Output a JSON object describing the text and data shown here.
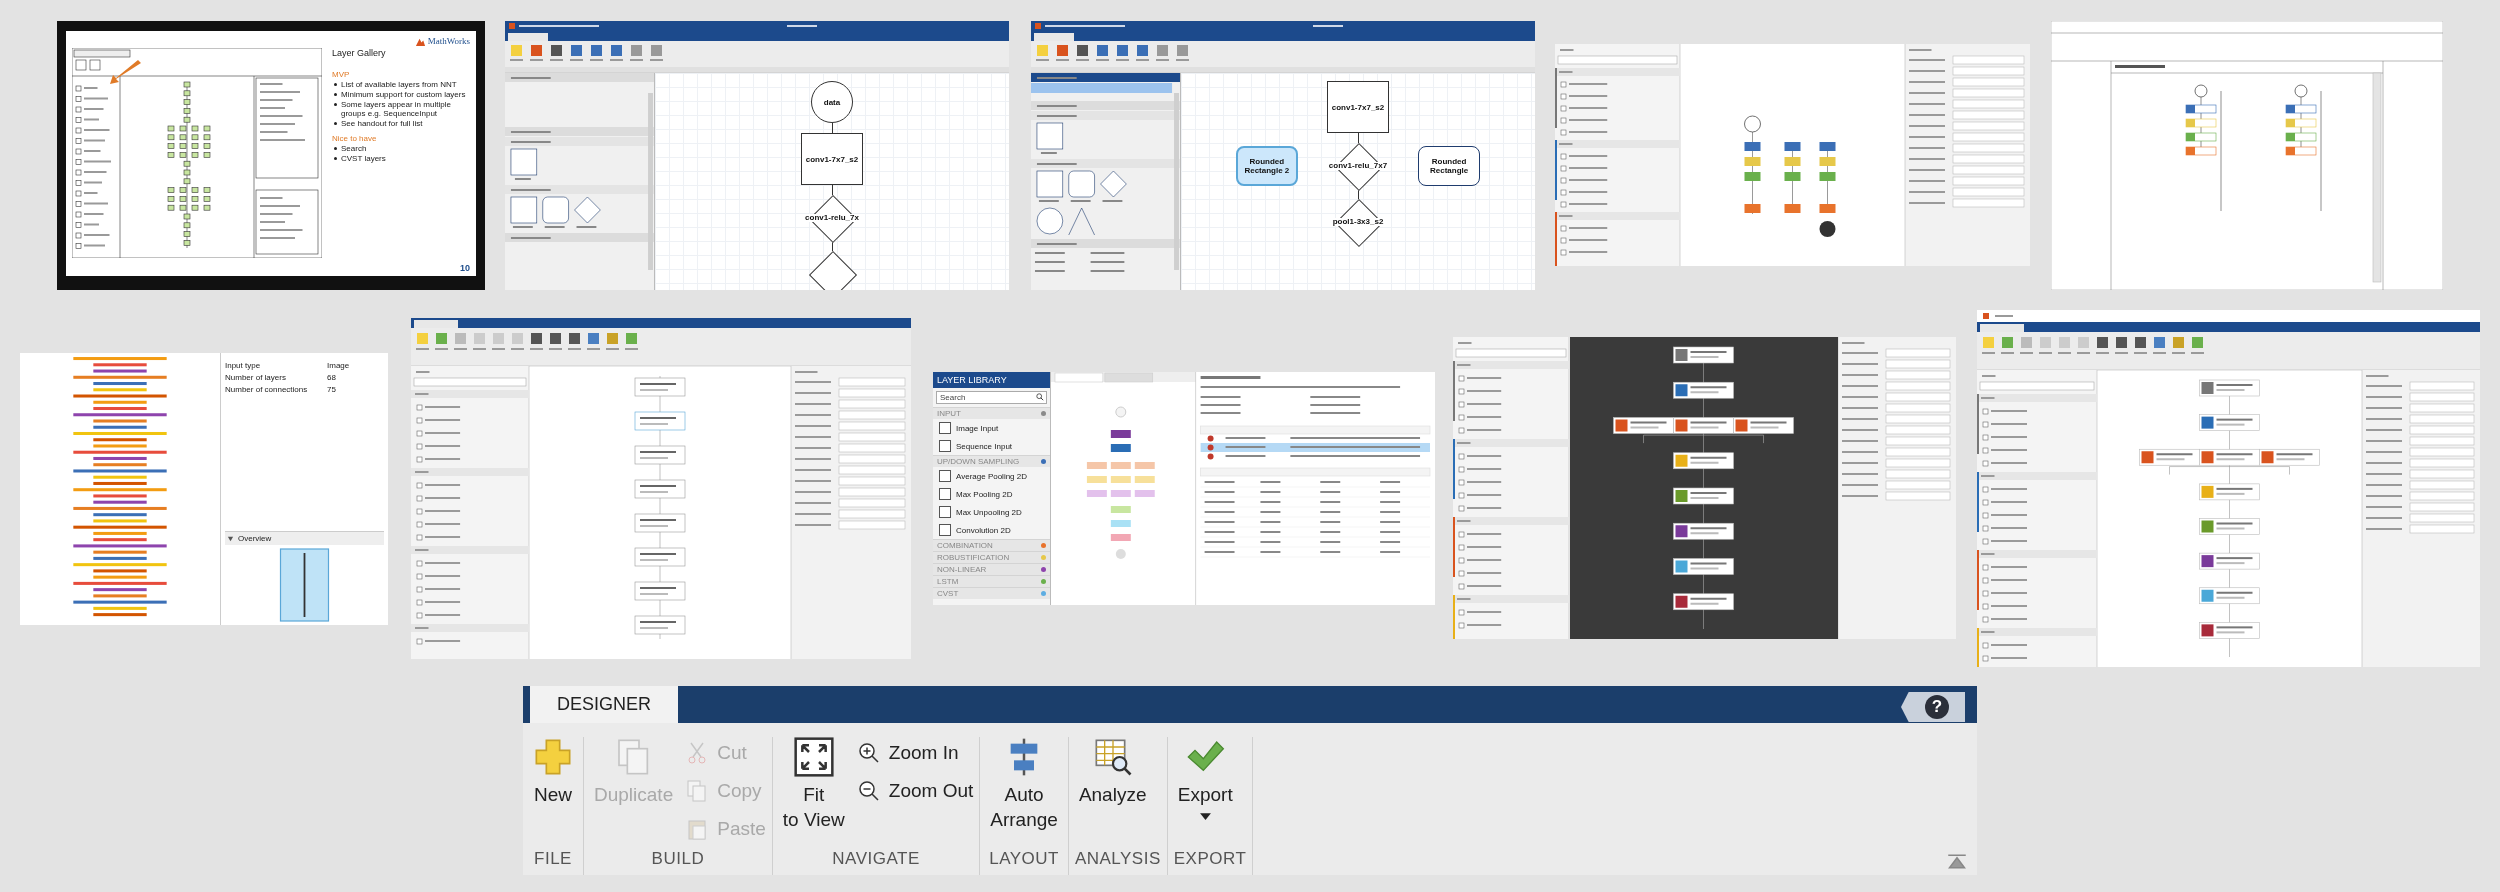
{
  "thumbnails": [
    {
      "kind": "slide",
      "logo": "MathWorks",
      "page": "10",
      "notes": {
        "title": "Layer Gallery",
        "groups": [
          {
            "heading": "MVP",
            "bullets": [
              "List of available layers from NNT",
              "Minimum support for custom layers",
              "Some layers appear in multiple groups e.g. SequenceInput",
              "See handout for full list"
            ]
          },
          {
            "heading": "Nice to have",
            "bullets": [
              "Search",
              "CVST layers"
            ]
          }
        ]
      }
    },
    {
      "kind": "diagram",
      "rows": [
        [
          {
            "kind": "circle",
            "label": "data"
          }
        ],
        [
          {
            "kind": "square",
            "label": "conv1-7x7_s2"
          }
        ],
        [
          {
            "kind": "diamond",
            "label": "conv1-relu_7x"
          }
        ],
        [
          {
            "kind": "diamond"
          }
        ]
      ]
    },
    {
      "kind": "diagram",
      "rows": [
        [
          {
            "kind": "square",
            "label": "conv1-7x7_s2"
          }
        ],
        [
          {
            "kind": "rounded",
            "label": "Rounded Rectangle 2",
            "selected": true
          },
          {
            "kind": "diamond",
            "label": "conv1-relu_7x7"
          },
          {
            "kind": "rounded",
            "label": "Rounded Rectangle",
            "selected": false
          }
        ],
        [
          {
            "kind": "diamond",
            "label": "pool1-3x3_s2"
          }
        ]
      ]
    },
    {
      "kind": "picture"
    },
    {
      "kind": "picture"
    },
    {
      "kind": "overview",
      "rows": [
        {
          "label": "Input type",
          "value": "Image"
        },
        {
          "label": "Number of layers",
          "value": "68"
        },
        {
          "label": "Number of connections",
          "value": "75"
        }
      ],
      "overview": "Overview"
    },
    {
      "kind": "picture"
    },
    {
      "kind": "library",
      "header": "LAYER LIBRARY",
      "placeholder": "Search",
      "sections": [
        {
          "heading": "INPUT",
          "color": "#8a8a8a",
          "items": [
            "Image Input",
            "Sequence Input"
          ]
        },
        {
          "heading": "UP/DOWN SAMPLING",
          "color": "#3b6fb6",
          "items": [
            "Average Pooling 2D",
            "Max Pooling 2D",
            "Max Unpooling 2D",
            "Convolution 2D"
          ]
        },
        {
          "heading": "COMBINATION",
          "color": "#e8732c"
        },
        {
          "heading": "ROBUSTIFICATION",
          "color": "#e6c84a"
        },
        {
          "heading": "NON-LINEAR",
          "color": "#8e44ad"
        },
        {
          "heading": "LSTM",
          "color": "#6ab04c"
        },
        {
          "heading": "CVST",
          "color": "#5dade2"
        }
      ]
    },
    {
      "kind": "picture"
    },
    {
      "kind": "picture"
    }
  ],
  "toolstrip": {
    "tabs": [
      {
        "label": "DESIGNER",
        "selected": true
      }
    ],
    "help": "?",
    "groups": [
      {
        "label": "FILE",
        "buttons": [
          {
            "label": "New",
            "kind": "large",
            "disabled": false
          }
        ]
      },
      {
        "label": "BUILD",
        "buttons": [
          {
            "label": "Duplicate",
            "kind": "large",
            "disabled": true
          },
          {
            "label": "Cut",
            "kind": "small",
            "disabled": true
          },
          {
            "label": "Copy",
            "kind": "small",
            "disabled": true
          },
          {
            "label": "Paste",
            "kind": "small",
            "disabled": true
          }
        ]
      },
      {
        "label": "NAVIGATE",
        "buttons": [
          {
            "label": "Fit\nto View",
            "kind": "large",
            "disabled": false
          },
          {
            "label": "Zoom In",
            "kind": "small",
            "disabled": false
          },
          {
            "label": "Zoom Out",
            "kind": "small",
            "disabled": false
          }
        ]
      },
      {
        "label": "LAYOUT",
        "buttons": [
          {
            "label": "Auto\nArrange",
            "kind": "large",
            "disabled": false
          }
        ]
      },
      {
        "label": "ANALYSIS",
        "buttons": [
          {
            "label": "Analyze",
            "kind": "large",
            "disabled": false
          }
        ]
      },
      {
        "label": "EXPORT",
        "buttons": [
          {
            "label": "Export",
            "kind": "large",
            "disabled": false,
            "dropdown": true
          }
        ]
      }
    ]
  }
}
